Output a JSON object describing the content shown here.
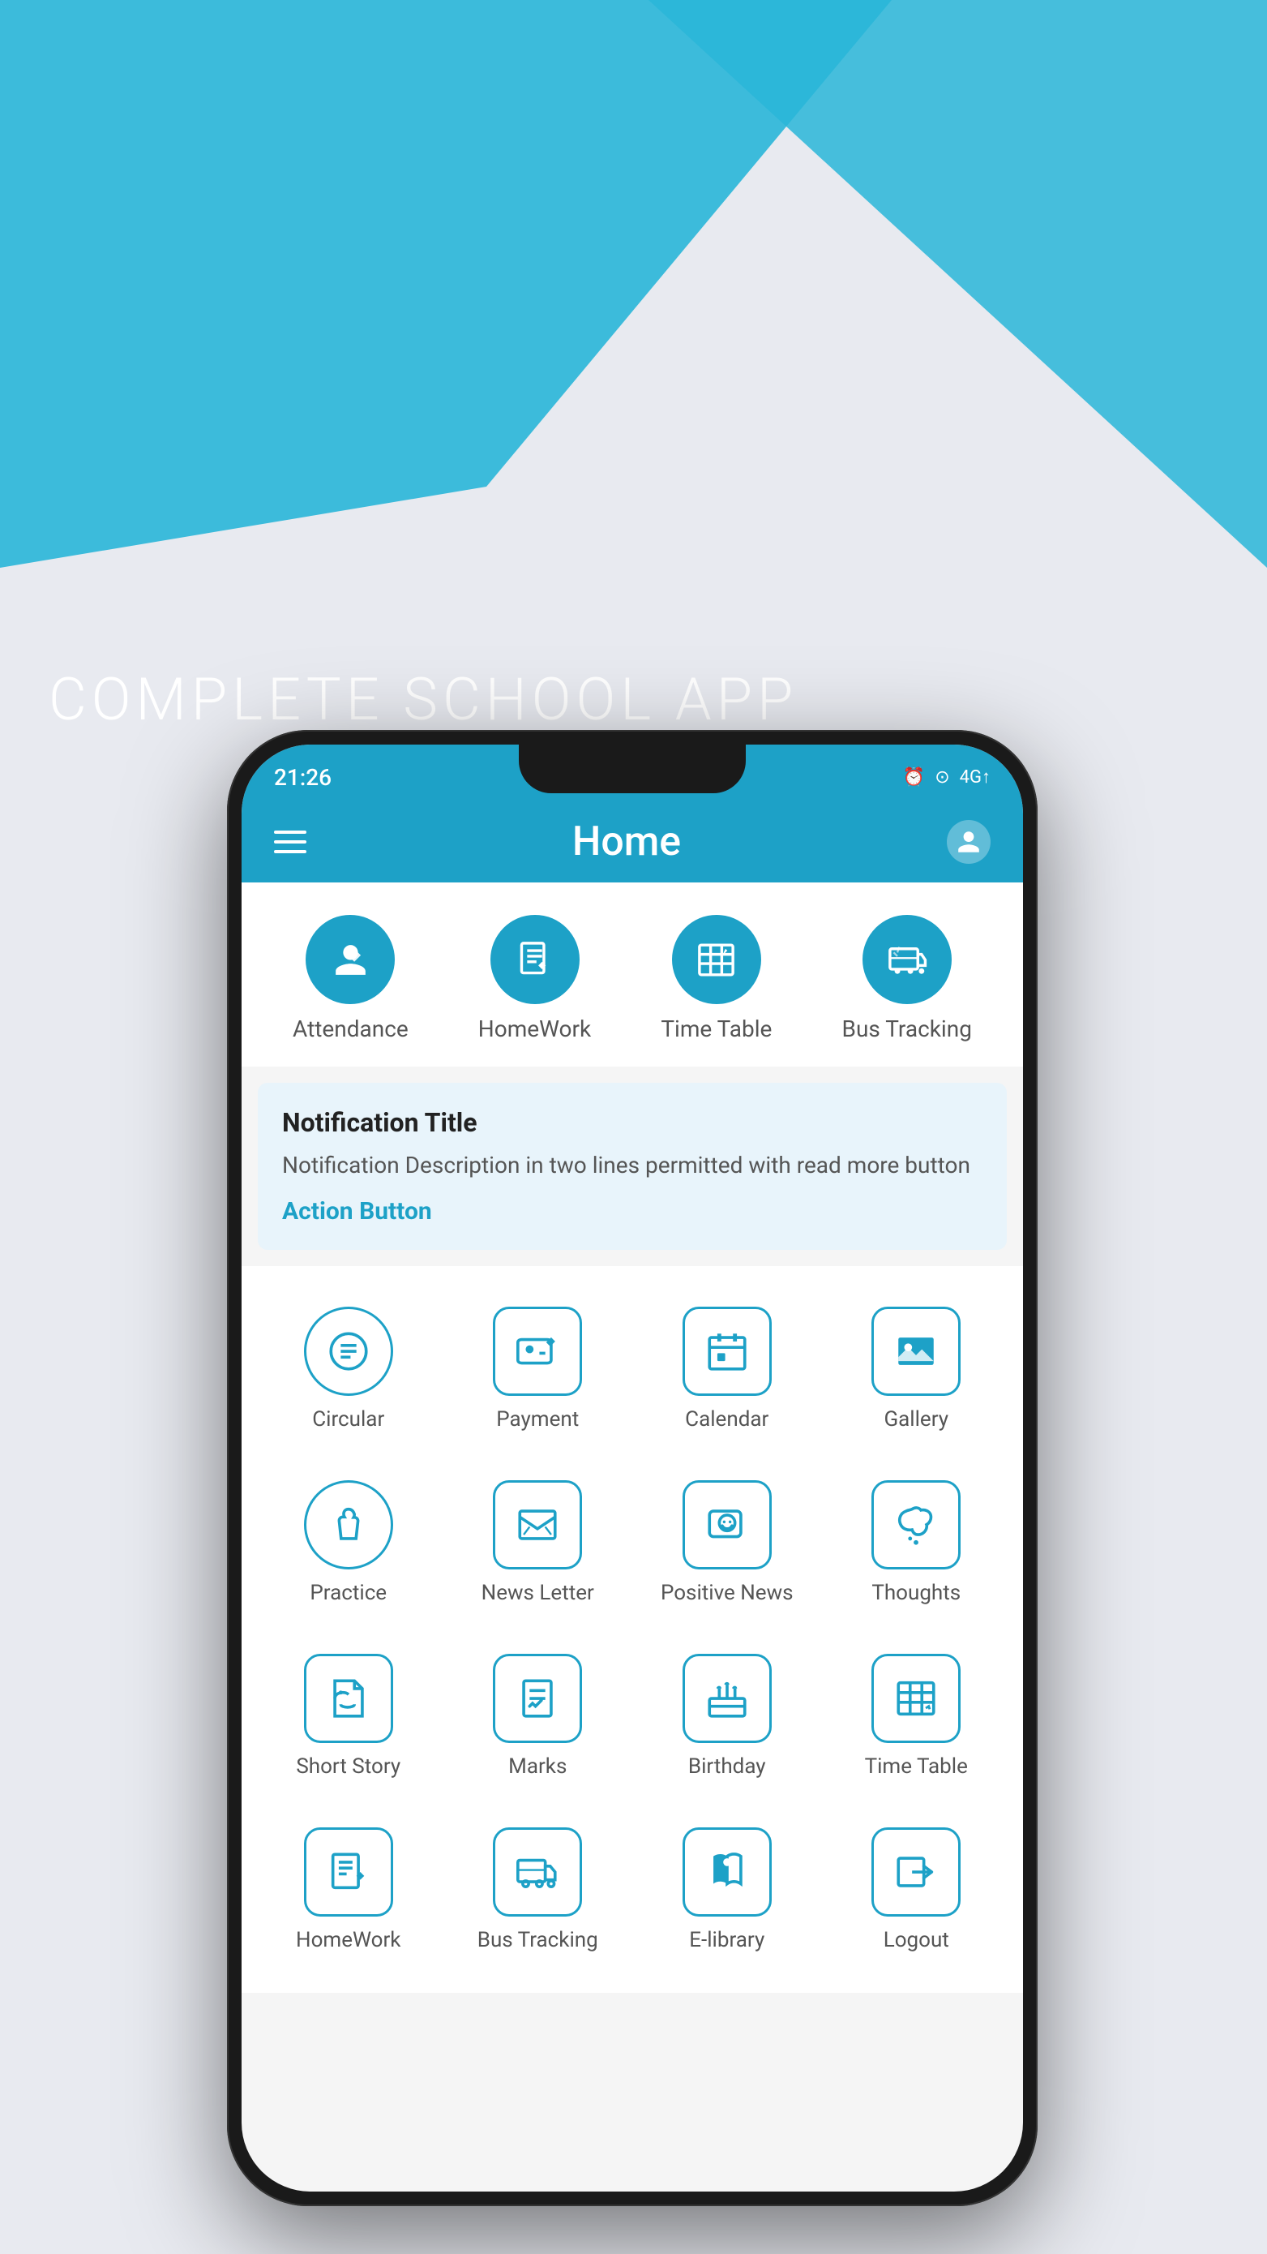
{
  "hero": {
    "title": "COMPLETE SCHOOL APP"
  },
  "status_bar": {
    "time": "21:26",
    "icons": "⏰ ⊛ 4G ▲"
  },
  "app_bar": {
    "title": "Home",
    "menu_label": "Menu",
    "account_label": "Account"
  },
  "top_row": {
    "items": [
      {
        "label": "Attendance",
        "icon": "attendance"
      },
      {
        "label": "HomeWork",
        "icon": "homework"
      },
      {
        "label": "Time Table",
        "icon": "timetable"
      },
      {
        "label": "Bus Tracking",
        "icon": "bus"
      }
    ]
  },
  "notification": {
    "title": "Notification Title",
    "description": "Notification Description in two lines permitted with read more button",
    "action": "Action Button"
  },
  "grid_rows": [
    [
      {
        "label": "Circular",
        "icon": "circular"
      },
      {
        "label": "Payment",
        "icon": "payment"
      },
      {
        "label": "Calendar",
        "icon": "calendar"
      },
      {
        "label": "Gallery",
        "icon": "gallery"
      }
    ],
    [
      {
        "label": "Practice",
        "icon": "practice"
      },
      {
        "label": "News Letter",
        "icon": "newsletter"
      },
      {
        "label": "Positive News",
        "icon": "positive"
      },
      {
        "label": "Thoughts",
        "icon": "thoughts"
      }
    ],
    [
      {
        "label": "Short Story",
        "icon": "shortstory"
      },
      {
        "label": "Marks",
        "icon": "marks"
      },
      {
        "label": "Birthday",
        "icon": "birthday"
      },
      {
        "label": "Time Table",
        "icon": "timetable2"
      }
    ],
    [
      {
        "label": "HomeWork",
        "icon": "homework2"
      },
      {
        "label": "Bus Tracking",
        "icon": "bus2"
      },
      {
        "label": "E-library",
        "icon": "elibrary"
      },
      {
        "label": "Logout",
        "icon": "logout"
      }
    ]
  ],
  "colors": {
    "primary": "#1da1c7",
    "text_dark": "#222222",
    "text_medium": "#555555",
    "bg_notif": "#e8f4fb",
    "white": "#ffffff"
  }
}
